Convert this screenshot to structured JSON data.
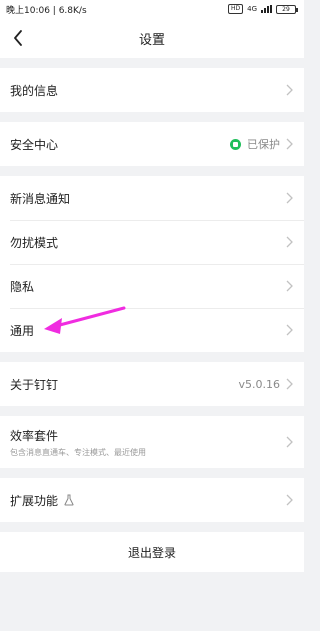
{
  "status_bar": {
    "time": "晚上10:06 | 6.8K/s",
    "net_label": "4G",
    "battery": "29"
  },
  "nav": {
    "title": "设置",
    "back_icon": "chevron-left-icon"
  },
  "groups": {
    "profile": {
      "label": "我的信息"
    },
    "security": {
      "label": "安全中心",
      "status": "已保护",
      "status_color": "#1fbe5a"
    },
    "notify": {
      "label": "新消息通知"
    },
    "dnd": {
      "label": "勿扰模式"
    },
    "privacy": {
      "label": "隐私"
    },
    "general": {
      "label": "通用"
    },
    "about": {
      "label": "关于钉钉",
      "version": "v5.0.16"
    },
    "efficiency": {
      "label": "效率套件",
      "sub": "包含消息直通车、专注模式、最近使用"
    },
    "extension": {
      "label": "扩展功能",
      "icon": "flask-icon"
    }
  },
  "logout": {
    "label": "退出登录"
  },
  "annotation": {
    "arrow_color": "#f02ce0"
  }
}
